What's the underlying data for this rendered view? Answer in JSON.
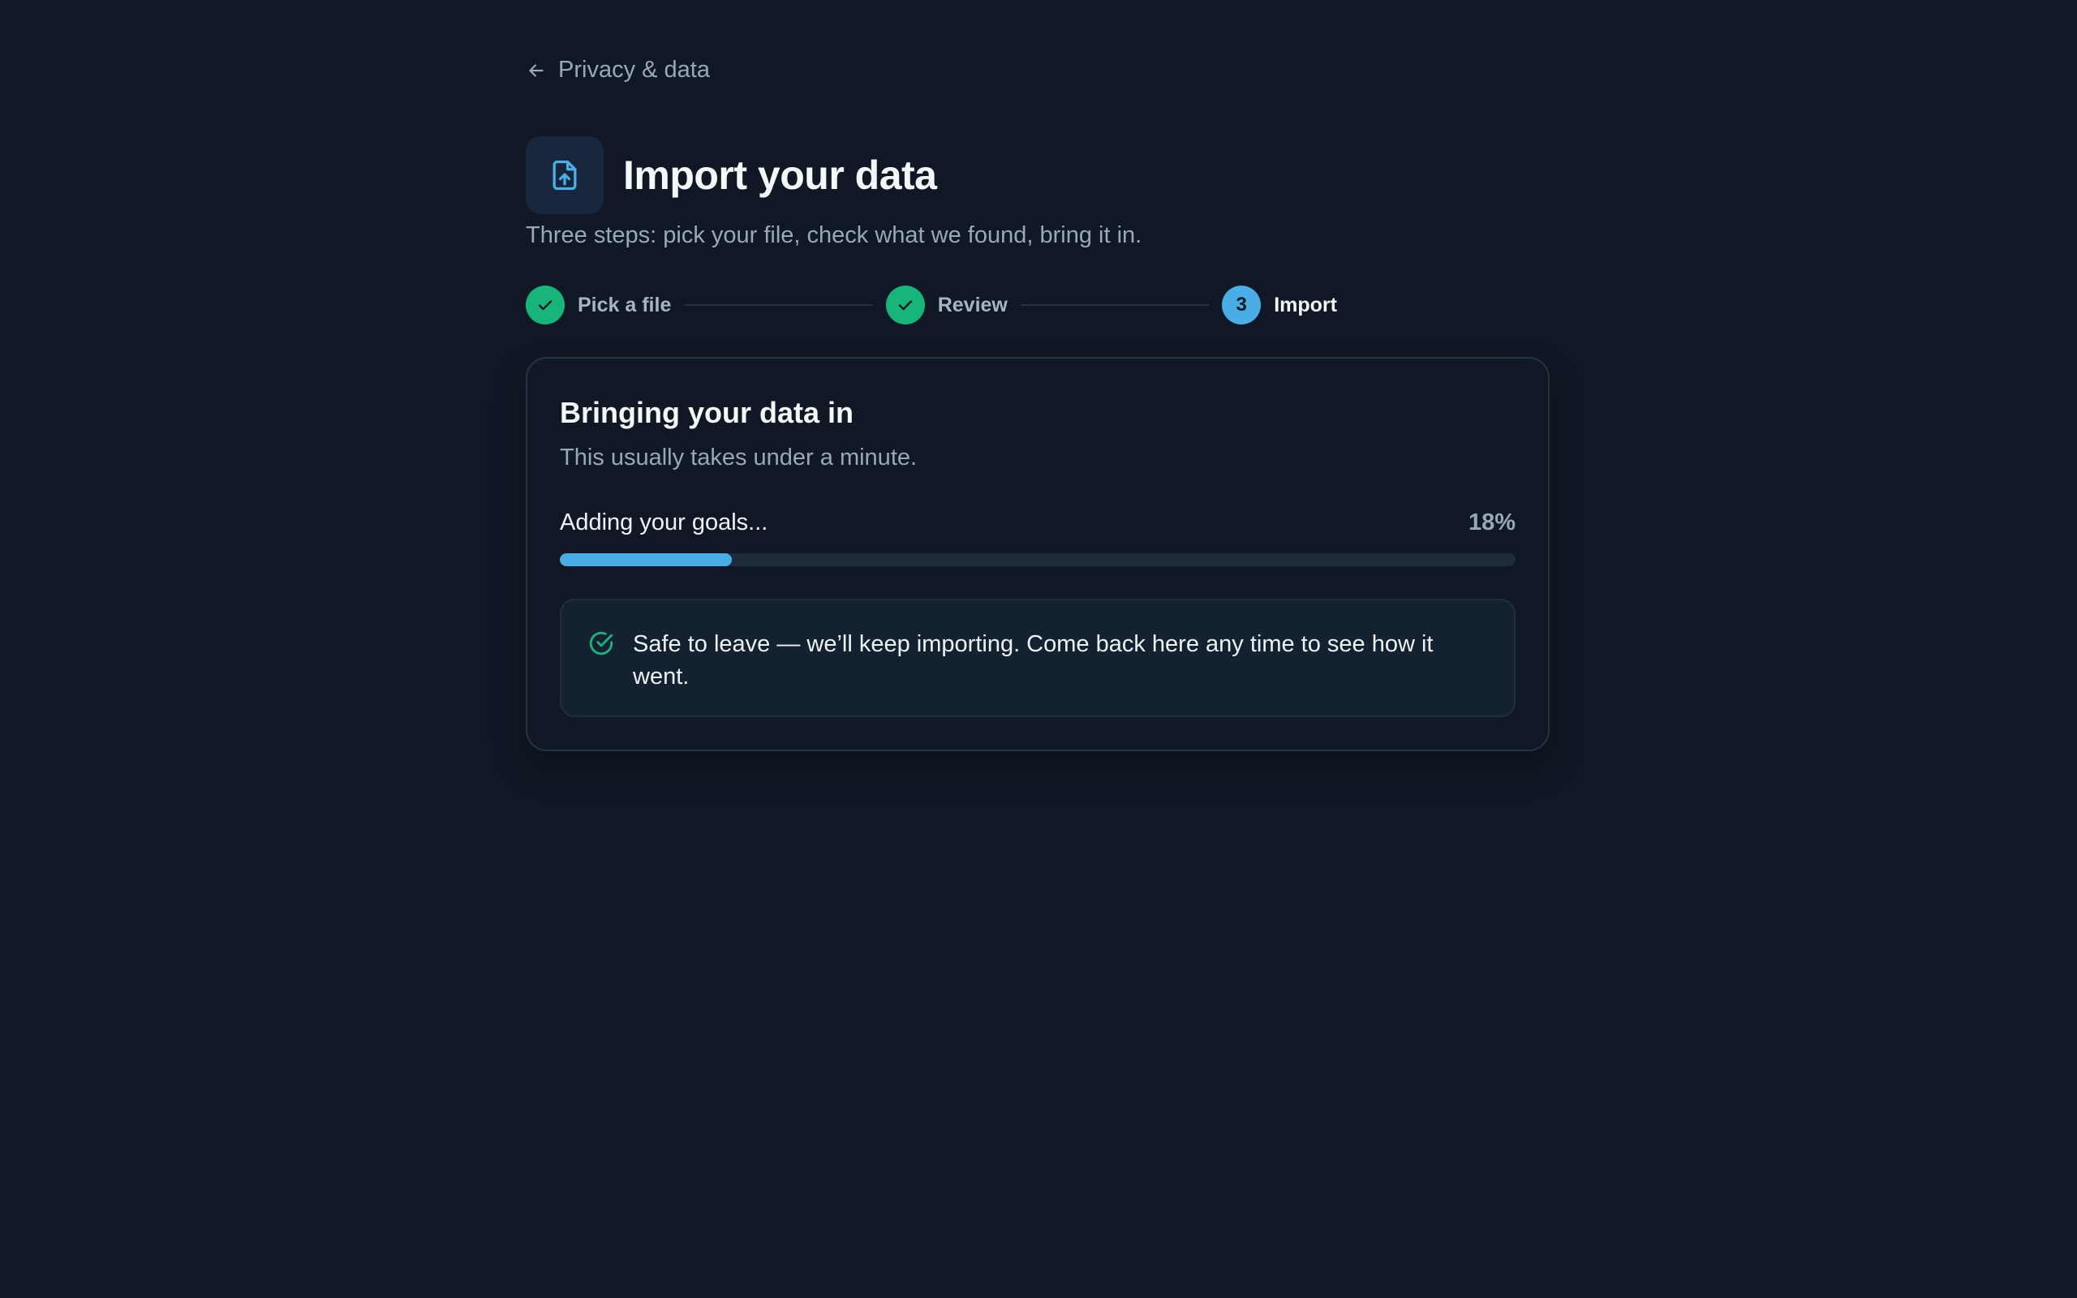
{
  "back_link": {
    "label": "Privacy & data",
    "icon": "arrow-left-icon"
  },
  "header": {
    "title": "Import your data",
    "icon": "file-upload-icon",
    "subtitle": "Three steps: pick your file, check what we found, bring it in."
  },
  "stepper": {
    "steps": [
      {
        "label": "Pick a file",
        "state": "done",
        "marker": ""
      },
      {
        "label": "Review",
        "state": "done",
        "marker": ""
      },
      {
        "label": "Import",
        "state": "active",
        "marker": "3"
      }
    ]
  },
  "card": {
    "title": "Bringing your data in",
    "subtitle": "This usually takes under a minute.",
    "progress": {
      "label": "Adding your goals...",
      "percent_text": "18%",
      "value": 18
    },
    "notice": {
      "icon": "check-circle-icon",
      "text": "Safe to leave — we’ll keep importing. Come back here any time to see how it went."
    }
  },
  "colors": {
    "background": "#0f1824",
    "accent": "#4aaee6",
    "success": "#16b57a"
  }
}
